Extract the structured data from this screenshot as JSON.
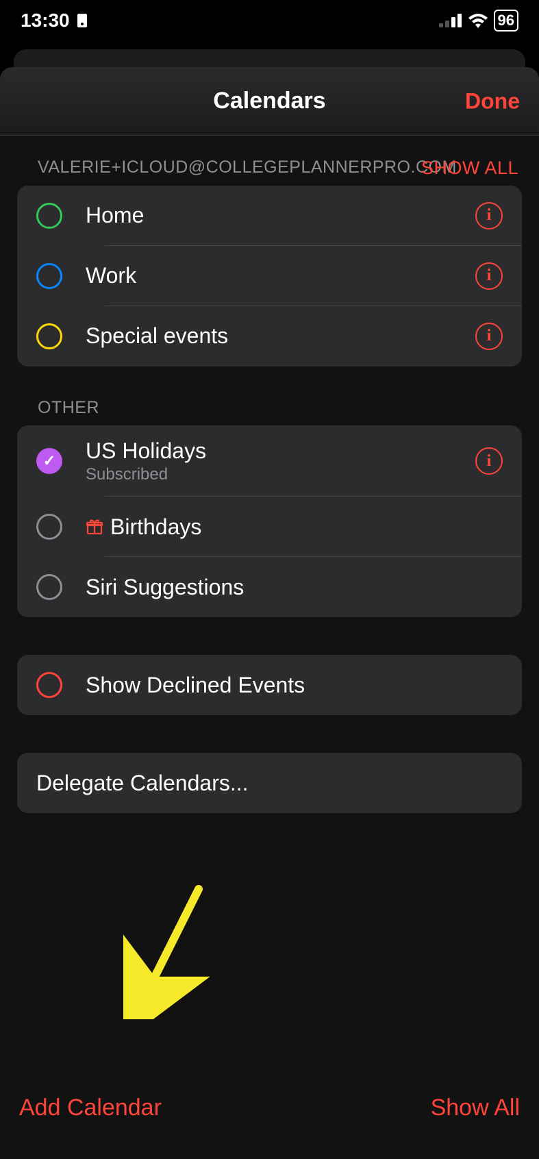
{
  "status": {
    "time": "13:30",
    "battery": "96"
  },
  "sheet": {
    "title": "Calendars",
    "done": "Done"
  },
  "sections": [
    {
      "label": "VALERIE+ICLOUD@COLLEGEPLANNERPRO.COM",
      "action": "SHOW ALL",
      "items": [
        {
          "title": "Home",
          "color": "#34c759",
          "checked": false,
          "info": true
        },
        {
          "title": "Work",
          "color": "#0a84ff",
          "checked": false,
          "info": true
        },
        {
          "title": "Special events",
          "color": "#ffd60a",
          "checked": false,
          "info": true
        }
      ]
    },
    {
      "label": "OTHER",
      "items": [
        {
          "title": "US Holidays",
          "subtitle": "Subscribed",
          "color": "#bf5af2",
          "checked": true,
          "info": true
        },
        {
          "title": "Birthdays",
          "color": "#8e8e93",
          "checked": false,
          "info": false,
          "icon": "gift"
        },
        {
          "title": "Siri Suggestions",
          "color": "#8e8e93",
          "checked": false,
          "info": false
        }
      ]
    }
  ],
  "declined": {
    "label": "Show Declined Events",
    "color": "#ff453a"
  },
  "delegate": {
    "label": "Delegate Calendars..."
  },
  "footer": {
    "add": "Add Calendar",
    "showAll": "Show All"
  }
}
